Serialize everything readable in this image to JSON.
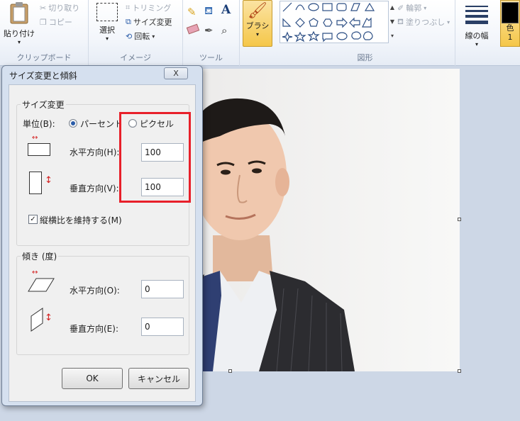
{
  "ribbon": {
    "clipboard": {
      "paste": "貼り付け",
      "cut": "切り取り",
      "copy": "コピー",
      "label": "クリップボード"
    },
    "image": {
      "select": "選択",
      "crop": "トリミング",
      "resize": "サイズ変更",
      "rotate": "回転",
      "label": "イメージ"
    },
    "tools": {
      "label": "ツール",
      "text_glyph": "A"
    },
    "brush": {
      "label": "ブラシ"
    },
    "shapes": {
      "outline": "輪郭",
      "fill": "塗りつぶし",
      "label": "図形"
    },
    "size": {
      "label": "線の幅"
    },
    "color": {
      "label": "色",
      "num": "1"
    }
  },
  "dialog": {
    "title": "サイズ変更と傾斜",
    "close_glyph": "X",
    "resize": {
      "legend": "サイズ変更",
      "unit_label": "単位(B):",
      "percent": "パーセント",
      "pixel": "ピクセル",
      "horizontal_label": "水平方向(H):",
      "horizontal_value": "100",
      "vertical_label": "垂直方向(V):",
      "vertical_value": "100",
      "keep_ratio": "縦横比を維持する(M)",
      "keep_ratio_checked": true
    },
    "skew": {
      "legend": "傾き (度)",
      "horizontal_label": "水平方向(O):",
      "horizontal_value": "0",
      "vertical_label": "垂直方向(E):",
      "vertical_value": "0"
    },
    "ok": "OK",
    "cancel": "キャンセル"
  },
  "colors": {
    "highlight": "#e8202a",
    "brush_active": "#f5c74a"
  }
}
